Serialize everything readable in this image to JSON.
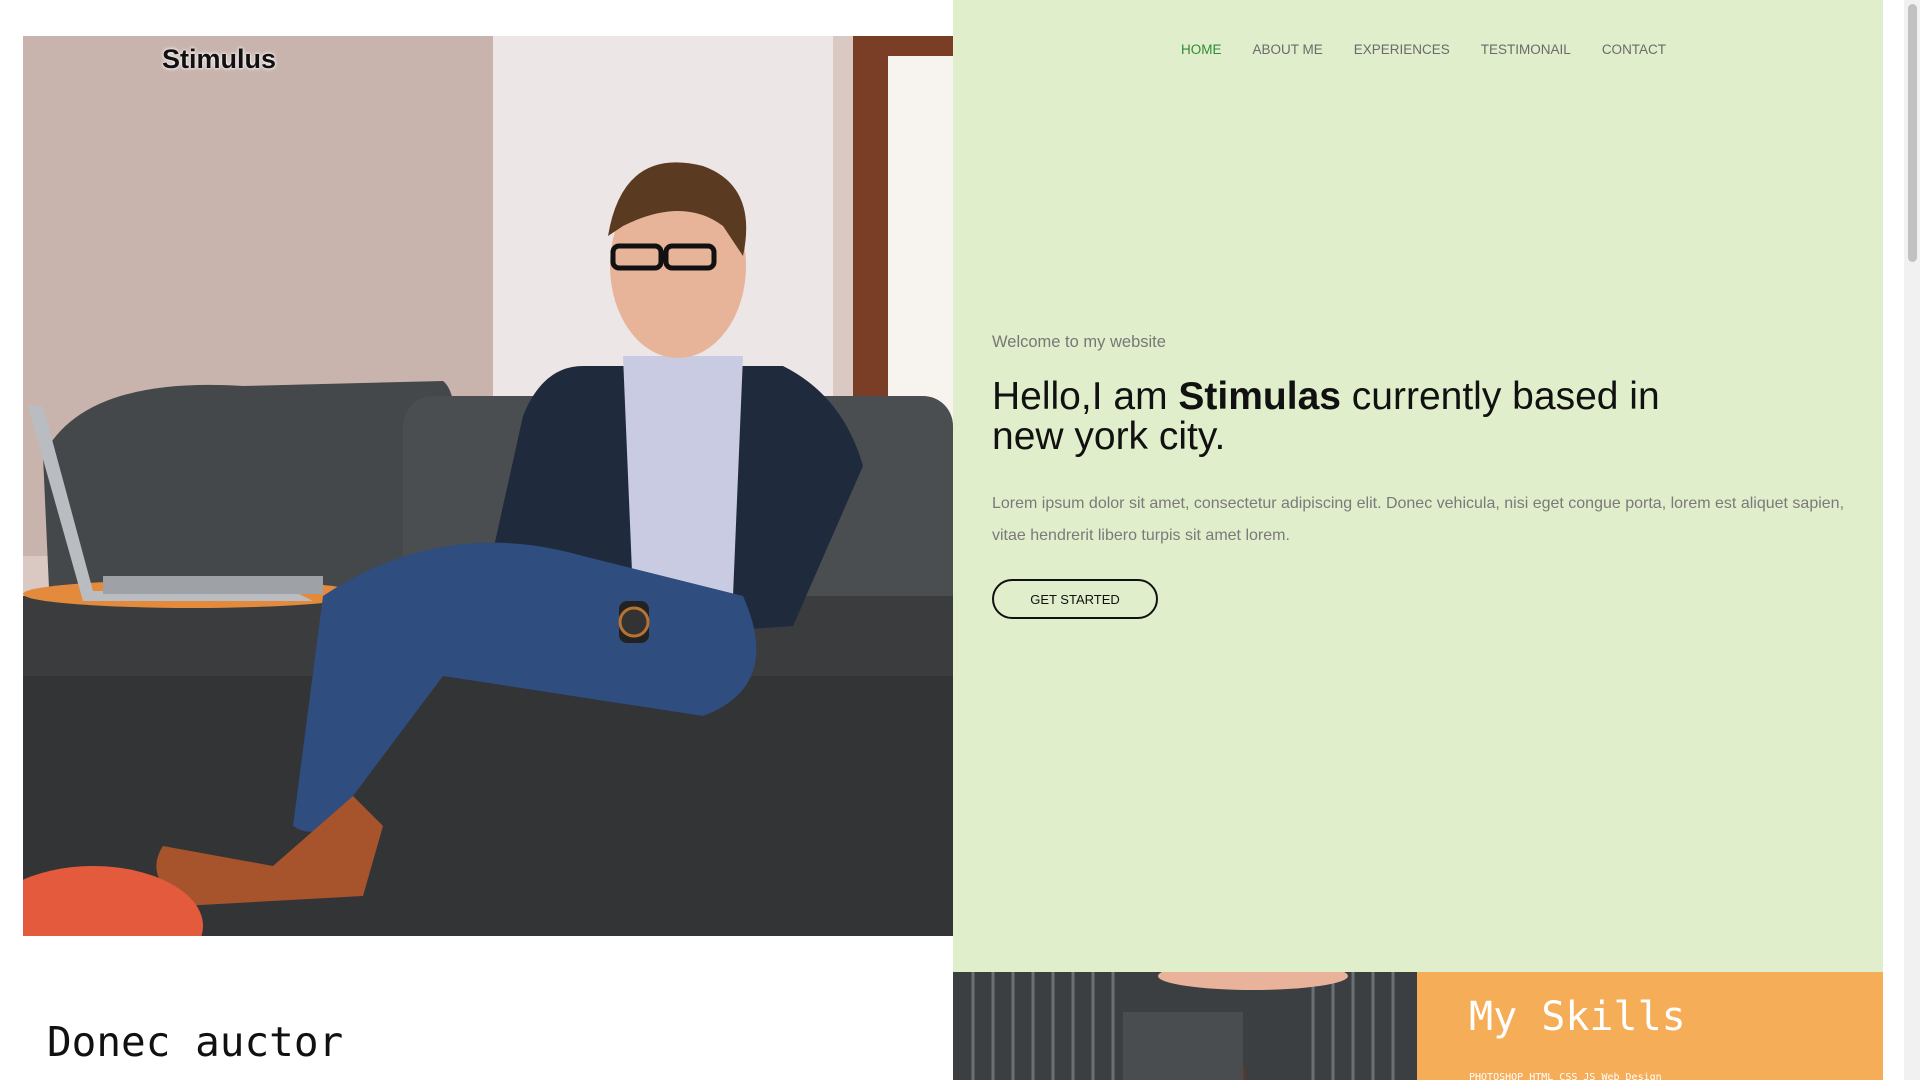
{
  "brand": {
    "name": "Stimulus"
  },
  "nav": {
    "items": [
      {
        "label": "HOME",
        "active": true
      },
      {
        "label": "ABOUT ME",
        "active": false
      },
      {
        "label": "EXPERIENCES",
        "active": false
      },
      {
        "label": "TESTIMONAIL",
        "active": false
      },
      {
        "label": "CONTACT",
        "active": false
      }
    ]
  },
  "hero": {
    "welcome": "Welcome to my website",
    "headline_pre": "Hello,I am ",
    "headline_name": "Stimulas",
    "headline_post": " currently based in new york city.",
    "lead": "Lorem ipsum dolor sit amet, consectetur adipiscing elit. Donec vehicula, nisi eget congue porta, lorem est aliquet sapien, vitae hendrerit libero turpis sit amet lorem.",
    "button_label": "GET STARTED"
  },
  "about": {
    "title": "Donec auctor"
  },
  "skills": {
    "title": "My Skills",
    "subtitle": "PHOTOSHOP HTML CSS JS Web Design"
  },
  "colors": {
    "panel_bg": "#e1eecb",
    "nav_active": "#2f8b37",
    "skills_bg": "#f6ad57"
  }
}
